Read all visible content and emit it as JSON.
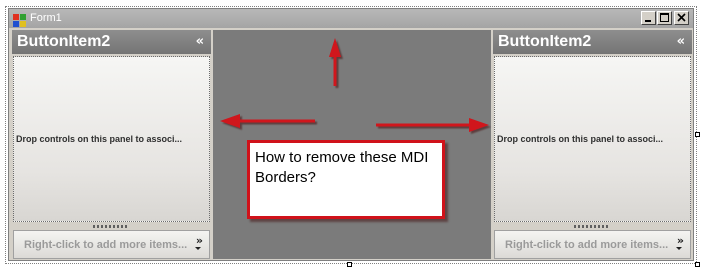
{
  "window": {
    "title": "Form1",
    "caption_buttons": [
      "minimize-icon",
      "maximize-icon",
      "close-icon"
    ]
  },
  "panels": [
    {
      "header": "ButtonItem2",
      "collapse_glyph": "«",
      "body_text": "Drop controls on this panel to associ...",
      "footer_text": "Right-click to add more items...",
      "footer_glyph": "»"
    },
    {
      "header": "ButtonItem2",
      "collapse_glyph": "«",
      "body_text": "Drop controls on this panel to associ...",
      "footer_text": "Right-click to add more items...",
      "footer_glyph": "»"
    }
  ],
  "annotation": {
    "text": "How to remove these MDI Borders?",
    "arrows": [
      "up-arrow",
      "left-arrow",
      "right-arrow"
    ]
  },
  "colors": {
    "mdi_background": "#7b7b7b",
    "annotation_red": "#d0121a",
    "panel_header": "#808080"
  }
}
